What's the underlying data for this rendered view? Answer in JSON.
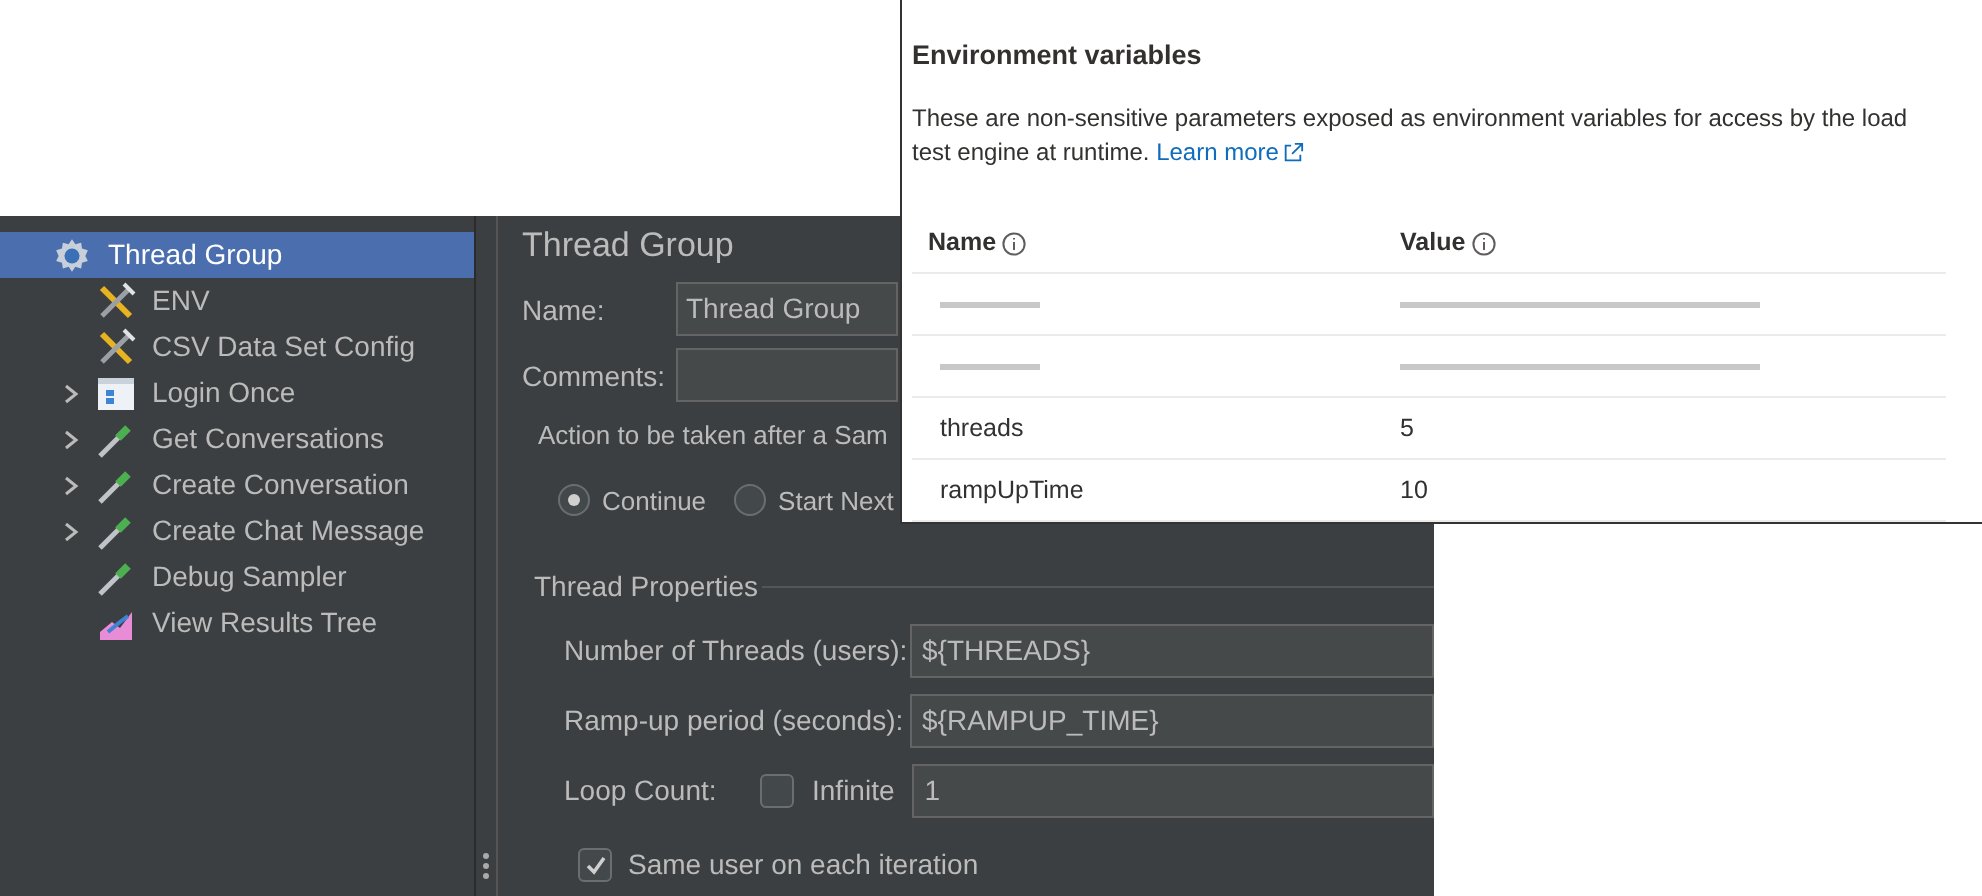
{
  "tree": {
    "items": [
      {
        "label": "Thread Group",
        "kind": "threadgroup",
        "selected": true,
        "expandable": false,
        "children": [
          {
            "label": "ENV",
            "kind": "config",
            "selected": false,
            "expandable": false
          },
          {
            "label": "CSV Data Set Config",
            "kind": "config",
            "selected": false,
            "expandable": false
          },
          {
            "label": "Login Once",
            "kind": "controller",
            "selected": false,
            "expandable": true
          },
          {
            "label": "Get Conversations",
            "kind": "sampler",
            "selected": false,
            "expandable": true
          },
          {
            "label": "Create Conversation",
            "kind": "sampler",
            "selected": false,
            "expandable": true
          },
          {
            "label": "Create Chat Message",
            "kind": "sampler",
            "selected": false,
            "expandable": true
          },
          {
            "label": "Debug Sampler",
            "kind": "sampler",
            "selected": false,
            "expandable": false
          },
          {
            "label": "View Results Tree",
            "kind": "listener",
            "selected": false,
            "expandable": false
          }
        ]
      }
    ]
  },
  "editor": {
    "title": "Thread Group",
    "name_label": "Name:",
    "name_value": "Thread Group",
    "comments_label": "Comments:",
    "action_legend": "Action to be taken after a Sam",
    "actions": [
      {
        "label": "Continue",
        "selected": true
      },
      {
        "label": "Start Next",
        "selected": false
      }
    ],
    "properties_legend": "Thread Properties",
    "fields": [
      {
        "label": "Number of Threads (users):",
        "value": "${THREADS}"
      },
      {
        "label": "Ramp-up period (seconds):",
        "value": "${RAMPUP_TIME}"
      }
    ],
    "loop_label": "Loop Count:",
    "infinite_label": "Infinite",
    "infinite_checked": false,
    "loop_value": "1",
    "same_user_label": "Same user on each iteration",
    "same_user_checked": true
  },
  "env_panel": {
    "title": "Environment variables",
    "description": "These are non-sensitive parameters exposed as environment variables for access by the load test engine at runtime.",
    "learn_more": "Learn more",
    "columns": [
      "Name",
      "Value"
    ],
    "rows": [
      {
        "kind": "redacted"
      },
      {
        "kind": "redacted"
      },
      {
        "kind": "plain",
        "name": "threads",
        "value": "5"
      },
      {
        "kind": "plain",
        "name": "rampUpTime",
        "value": "10"
      }
    ]
  }
}
